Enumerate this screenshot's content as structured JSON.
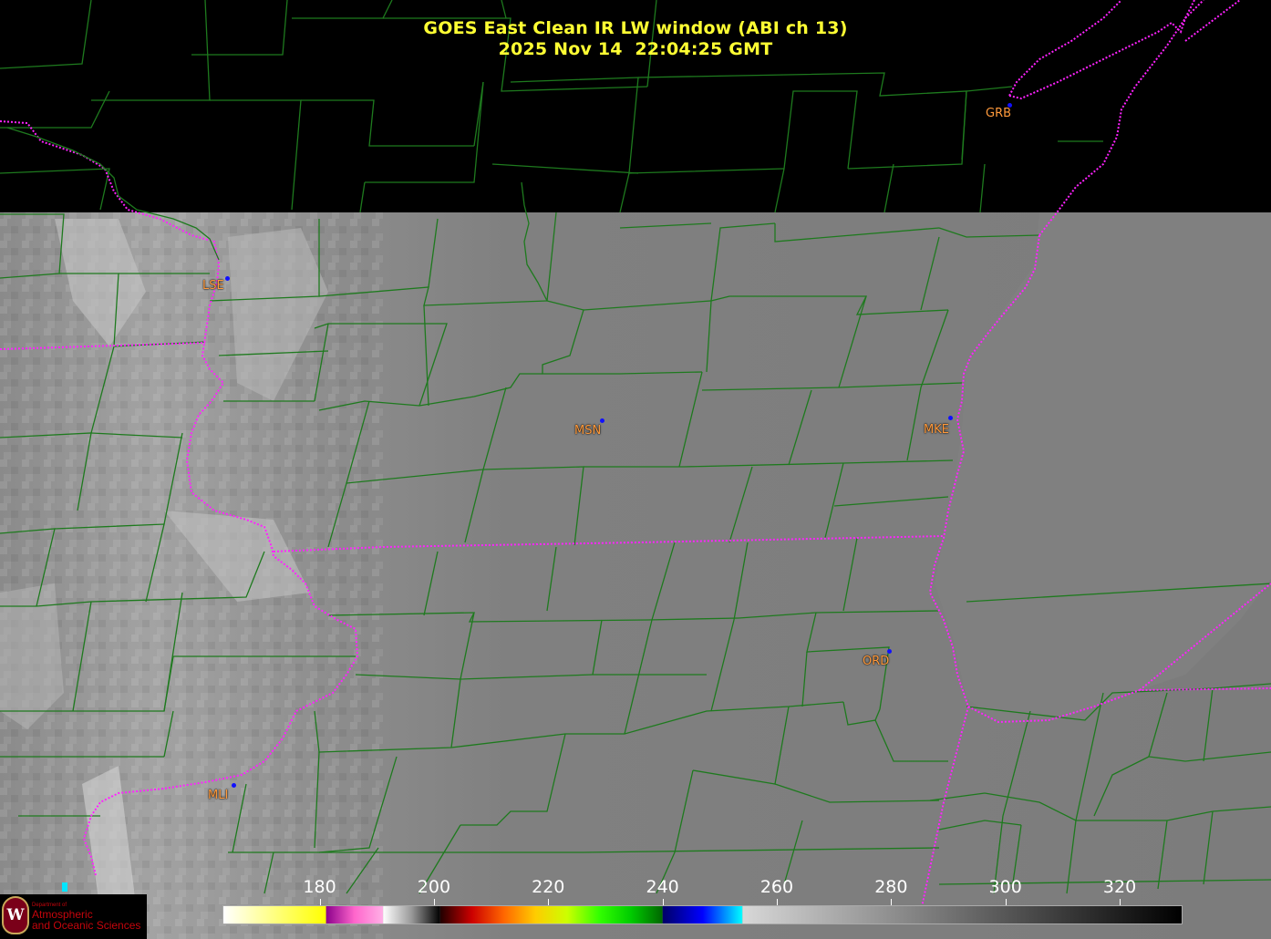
{
  "title": {
    "line1": "GOES East Clean IR LW window (ABI ch 13)",
    "line2": "2025 Nov 14  22:04:25 GMT"
  },
  "cities": [
    {
      "code": "GRB"
    },
    {
      "code": "LSE"
    },
    {
      "code": "MSN"
    },
    {
      "code": "MKE"
    },
    {
      "code": "ORD"
    },
    {
      "code": "MLI"
    }
  ],
  "colorbar": {
    "ticks": [
      "180",
      "200",
      "220",
      "240",
      "260",
      "280",
      "300",
      "320"
    ],
    "range": [
      163,
      331
    ],
    "unit_hint": ""
  },
  "logo": {
    "line1": "Department of",
    "line2": "Atmospheric",
    "line3": "and Oceanic Sciences",
    "seal": "W"
  },
  "colors": {
    "county_lines": "#1e7a1e",
    "state_lines": "#ff22ff",
    "title": "#ffff33",
    "city_label": "#ff9a3c",
    "city_dot": "#1010ff"
  }
}
